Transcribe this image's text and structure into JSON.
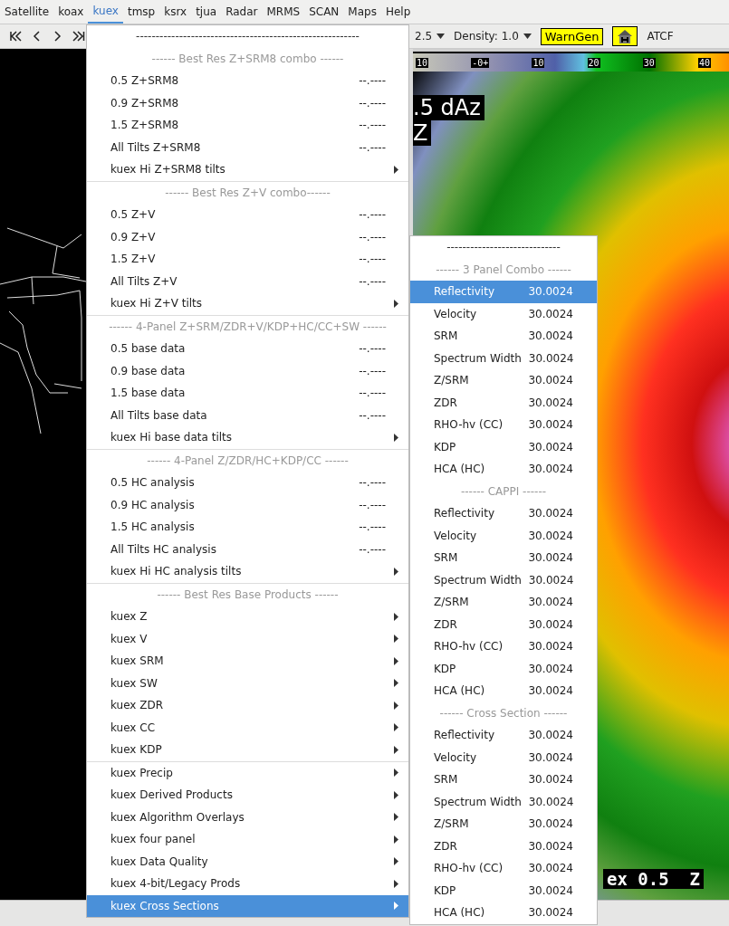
{
  "menubar": [
    {
      "label": "Satellite",
      "selected": false
    },
    {
      "label": "koax",
      "selected": false
    },
    {
      "label": "kuex",
      "selected": true
    },
    {
      "label": "tmsp",
      "selected": false
    },
    {
      "label": "ksrx",
      "selected": false
    },
    {
      "label": "tjua",
      "selected": false
    },
    {
      "label": "Radar",
      "selected": false
    },
    {
      "label": "MRMS",
      "selected": false
    },
    {
      "label": "SCAN",
      "selected": false
    },
    {
      "label": "Maps",
      "selected": false
    },
    {
      "label": "Help",
      "selected": false
    }
  ],
  "toolbar": {
    "magnification": "2.5",
    "density": "Density: 1.0",
    "warngen": "WarnGen",
    "atcf": "ATCF"
  },
  "radar": {
    "colorbar_labels": [
      "10",
      "-0+",
      "10",
      "20",
      "30",
      "40"
    ],
    "overlay_lines": [
      ".5 dAz",
      "Z"
    ],
    "bottom_label": "ex 0.5  Z"
  },
  "menu": {
    "groups": [
      {
        "items": [
          {
            "kind": "dashes",
            "label": "---------------------------------------------------------"
          },
          {
            "kind": "header",
            "label": "------ Best Res Z+SRM8 combo ------"
          },
          {
            "kind": "item",
            "label": "0.5 Z+SRM8",
            "value": "--.----",
            "selected": false
          },
          {
            "kind": "item",
            "label": "0.9 Z+SRM8",
            "value": "--.----",
            "selected": false
          },
          {
            "kind": "item",
            "label": "1.5 Z+SRM8",
            "value": "--.----",
            "selected": false
          },
          {
            "kind": "item",
            "label": "All Tilts Z+SRM8",
            "value": "--.----",
            "selected": false
          },
          {
            "kind": "submenu",
            "label": "kuex Hi Z+SRM8 tilts",
            "selected": false
          }
        ]
      },
      {
        "items": [
          {
            "kind": "header",
            "label": "------ Best Res Z+V combo------"
          },
          {
            "kind": "item",
            "label": "0.5 Z+V",
            "value": "--.----",
            "selected": false
          },
          {
            "kind": "item",
            "label": "0.9 Z+V",
            "value": "--.----",
            "selected": false
          },
          {
            "kind": "item",
            "label": "1.5 Z+V",
            "value": "--.----",
            "selected": false
          },
          {
            "kind": "item",
            "label": "All Tilts Z+V",
            "value": "--.----",
            "selected": false
          },
          {
            "kind": "submenu",
            "label": "kuex Hi Z+V tilts",
            "selected": false
          }
        ]
      },
      {
        "items": [
          {
            "kind": "header",
            "label": "------ 4-Panel Z+SRM/ZDR+V/KDP+HC/CC+SW ------"
          },
          {
            "kind": "item",
            "label": "0.5 base data",
            "value": "--.----",
            "selected": false
          },
          {
            "kind": "item",
            "label": "0.9 base data",
            "value": "--.----",
            "selected": false
          },
          {
            "kind": "item",
            "label": "1.5 base data",
            "value": "--.----",
            "selected": false
          },
          {
            "kind": "item",
            "label": "All Tilts base data",
            "value": "--.----",
            "selected": false
          },
          {
            "kind": "submenu",
            "label": "kuex Hi base data tilts",
            "selected": false
          }
        ]
      },
      {
        "items": [
          {
            "kind": "header",
            "label": "------ 4-Panel Z/ZDR/HC+KDP/CC ------"
          },
          {
            "kind": "item",
            "label": "0.5 HC analysis",
            "value": "--.----",
            "selected": false
          },
          {
            "kind": "item",
            "label": "0.9 HC analysis",
            "value": "--.----",
            "selected": false
          },
          {
            "kind": "item",
            "label": "1.5 HC analysis",
            "value": "--.----",
            "selected": false
          },
          {
            "kind": "item",
            "label": "All Tilts HC analysis",
            "value": "--.----",
            "selected": false
          },
          {
            "kind": "submenu",
            "label": "kuex Hi HC analysis tilts",
            "selected": false
          }
        ]
      },
      {
        "items": [
          {
            "kind": "header",
            "label": "------ Best Res Base Products ------"
          },
          {
            "kind": "submenu",
            "label": "kuex Z",
            "selected": false
          },
          {
            "kind": "submenu",
            "label": "kuex V",
            "selected": false
          },
          {
            "kind": "submenu",
            "label": "kuex SRM",
            "selected": false
          },
          {
            "kind": "submenu",
            "label": "kuex SW",
            "selected": false
          },
          {
            "kind": "submenu",
            "label": "kuex ZDR",
            "selected": false
          },
          {
            "kind": "submenu",
            "label": "kuex CC",
            "selected": false
          },
          {
            "kind": "submenu",
            "label": "kuex KDP",
            "selected": false
          }
        ]
      },
      {
        "items": [
          {
            "kind": "submenu",
            "label": "kuex Precip",
            "selected": false
          },
          {
            "kind": "submenu",
            "label": "kuex Derived Products",
            "selected": false
          },
          {
            "kind": "submenu",
            "label": "kuex Algorithm Overlays",
            "selected": false
          },
          {
            "kind": "submenu",
            "label": "kuex four panel",
            "selected": false
          },
          {
            "kind": "submenu",
            "label": "kuex Data Quality",
            "selected": false
          },
          {
            "kind": "submenu",
            "label": "kuex 4-bit/Legacy Prods",
            "selected": false
          },
          {
            "kind": "submenu",
            "label": "kuex Cross Sections",
            "selected": true
          }
        ]
      }
    ]
  },
  "submenu": {
    "items": [
      {
        "kind": "dashes",
        "label": "-----------------------------"
      },
      {
        "kind": "header",
        "label": "------ 3 Panel Combo ------"
      },
      {
        "kind": "item",
        "label": "Reflectivity",
        "value": "30.0024",
        "selected": true
      },
      {
        "kind": "item",
        "label": "Velocity",
        "value": "30.0024",
        "selected": false
      },
      {
        "kind": "item",
        "label": "SRM",
        "value": "30.0024",
        "selected": false
      },
      {
        "kind": "item",
        "label": "Spectrum Width",
        "value": "30.0024",
        "selected": false
      },
      {
        "kind": "item",
        "label": "Z/SRM",
        "value": "30.0024",
        "selected": false
      },
      {
        "kind": "item",
        "label": "ZDR",
        "value": "30.0024",
        "selected": false
      },
      {
        "kind": "item",
        "label": "RHO-hv (CC)",
        "value": "30.0024",
        "selected": false
      },
      {
        "kind": "item",
        "label": "KDP",
        "value": "30.0024",
        "selected": false
      },
      {
        "kind": "item",
        "label": "HCA (HC)",
        "value": "30.0024",
        "selected": false
      },
      {
        "kind": "header",
        "label": "------ CAPPI ------"
      },
      {
        "kind": "item",
        "label": "Reflectivity",
        "value": "30.0024",
        "selected": false
      },
      {
        "kind": "item",
        "label": "Velocity",
        "value": "30.0024",
        "selected": false
      },
      {
        "kind": "item",
        "label": "SRM",
        "value": "30.0024",
        "selected": false
      },
      {
        "kind": "item",
        "label": "Spectrum Width",
        "value": "30.0024",
        "selected": false
      },
      {
        "kind": "item",
        "label": "Z/SRM",
        "value": "30.0024",
        "selected": false
      },
      {
        "kind": "item",
        "label": "ZDR",
        "value": "30.0024",
        "selected": false
      },
      {
        "kind": "item",
        "label": "RHO-hv (CC)",
        "value": "30.0024",
        "selected": false
      },
      {
        "kind": "item",
        "label": "KDP",
        "value": "30.0024",
        "selected": false
      },
      {
        "kind": "item",
        "label": "HCA (HC)",
        "value": "30.0024",
        "selected": false
      },
      {
        "kind": "header",
        "label": "------ Cross Section ------"
      },
      {
        "kind": "item",
        "label": "Reflectivity",
        "value": "30.0024",
        "selected": false
      },
      {
        "kind": "item",
        "label": "Velocity",
        "value": "30.0024",
        "selected": false
      },
      {
        "kind": "item",
        "label": "SRM",
        "value": "30.0024",
        "selected": false
      },
      {
        "kind": "item",
        "label": "Spectrum Width",
        "value": "30.0024",
        "selected": false
      },
      {
        "kind": "item",
        "label": "Z/SRM",
        "value": "30.0024",
        "selected": false
      },
      {
        "kind": "item",
        "label": "ZDR",
        "value": "30.0024",
        "selected": false
      },
      {
        "kind": "item",
        "label": "RHO-hv (CC)",
        "value": "30.0024",
        "selected": false
      },
      {
        "kind": "item",
        "label": "KDP",
        "value": "30.0024",
        "selected": false
      },
      {
        "kind": "item",
        "label": "HCA (HC)",
        "value": "30.0024",
        "selected": false
      }
    ]
  }
}
